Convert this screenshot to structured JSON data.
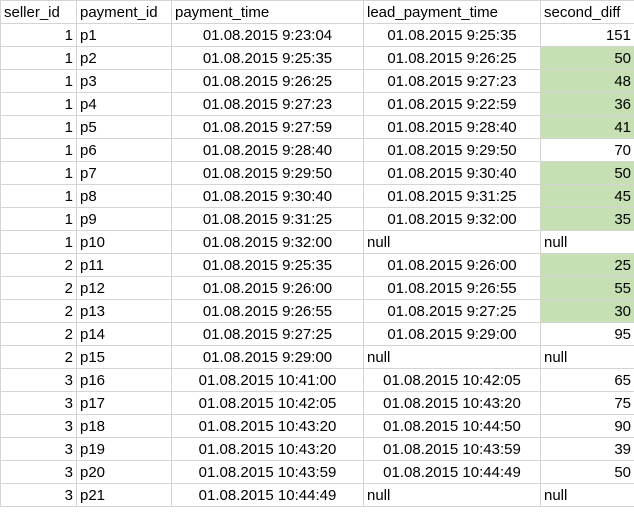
{
  "headers": [
    "seller_id",
    "payment_id",
    "payment_time",
    "lead_payment_time",
    "second_diff"
  ],
  "highlight_color": "#c6e0b4",
  "rows": [
    {
      "seller_id": "1",
      "payment_id": "p1",
      "payment_time": "01.08.2015 9:23:04",
      "lead_payment_time": "01.08.2015 9:25:35",
      "second_diff": "151",
      "highlight": false
    },
    {
      "seller_id": "1",
      "payment_id": "p2",
      "payment_time": "01.08.2015 9:25:35",
      "lead_payment_time": "01.08.2015 9:26:25",
      "second_diff": "50",
      "highlight": true
    },
    {
      "seller_id": "1",
      "payment_id": "p3",
      "payment_time": "01.08.2015 9:26:25",
      "lead_payment_time": "01.08.2015 9:27:23",
      "second_diff": "48",
      "highlight": true
    },
    {
      "seller_id": "1",
      "payment_id": "p4",
      "payment_time": "01.08.2015 9:27:23",
      "lead_payment_time": "01.08.2015 9:22:59",
      "second_diff": "36",
      "highlight": true
    },
    {
      "seller_id": "1",
      "payment_id": "p5",
      "payment_time": "01.08.2015 9:27:59",
      "lead_payment_time": "01.08.2015 9:28:40",
      "second_diff": "41",
      "highlight": true
    },
    {
      "seller_id": "1",
      "payment_id": "p6",
      "payment_time": "01.08.2015 9:28:40",
      "lead_payment_time": "01.08.2015 9:29:50",
      "second_diff": "70",
      "highlight": false
    },
    {
      "seller_id": "1",
      "payment_id": "p7",
      "payment_time": "01.08.2015 9:29:50",
      "lead_payment_time": "01.08.2015 9:30:40",
      "second_diff": "50",
      "highlight": true
    },
    {
      "seller_id": "1",
      "payment_id": "p8",
      "payment_time": "01.08.2015 9:30:40",
      "lead_payment_time": "01.08.2015 9:31:25",
      "second_diff": "45",
      "highlight": true
    },
    {
      "seller_id": "1",
      "payment_id": "p9",
      "payment_time": "01.08.2015 9:31:25",
      "lead_payment_time": "01.08.2015 9:32:00",
      "second_diff": "35",
      "highlight": true
    },
    {
      "seller_id": "1",
      "payment_id": "p10",
      "payment_time": "01.08.2015 9:32:00",
      "lead_payment_time": "null",
      "second_diff": "null",
      "highlight": false
    },
    {
      "seller_id": "2",
      "payment_id": "p11",
      "payment_time": "01.08.2015 9:25:35",
      "lead_payment_time": "01.08.2015 9:26:00",
      "second_diff": "25",
      "highlight": true
    },
    {
      "seller_id": "2",
      "payment_id": "p12",
      "payment_time": "01.08.2015 9:26:00",
      "lead_payment_time": "01.08.2015 9:26:55",
      "second_diff": "55",
      "highlight": true
    },
    {
      "seller_id": "2",
      "payment_id": "p13",
      "payment_time": "01.08.2015 9:26:55",
      "lead_payment_time": "01.08.2015 9:27:25",
      "second_diff": "30",
      "highlight": true
    },
    {
      "seller_id": "2",
      "payment_id": "p14",
      "payment_time": "01.08.2015 9:27:25",
      "lead_payment_time": "01.08.2015 9:29:00",
      "second_diff": "95",
      "highlight": false
    },
    {
      "seller_id": "2",
      "payment_id": "p15",
      "payment_time": "01.08.2015 9:29:00",
      "lead_payment_time": "null",
      "second_diff": "null",
      "highlight": false
    },
    {
      "seller_id": "3",
      "payment_id": "p16",
      "payment_time": "01.08.2015 10:41:00",
      "lead_payment_time": "01.08.2015 10:42:05",
      "second_diff": "65",
      "highlight": false
    },
    {
      "seller_id": "3",
      "payment_id": "p17",
      "payment_time": "01.08.2015 10:42:05",
      "lead_payment_time": "01.08.2015 10:43:20",
      "second_diff": "75",
      "highlight": false
    },
    {
      "seller_id": "3",
      "payment_id": "p18",
      "payment_time": "01.08.2015 10:43:20",
      "lead_payment_time": "01.08.2015 10:44:50",
      "second_diff": "90",
      "highlight": false
    },
    {
      "seller_id": "3",
      "payment_id": "p19",
      "payment_time": "01.08.2015 10:43:20",
      "lead_payment_time": "01.08.2015 10:43:59",
      "second_diff": "39",
      "highlight": false
    },
    {
      "seller_id": "3",
      "payment_id": "p20",
      "payment_time": "01.08.2015 10:43:59",
      "lead_payment_time": "01.08.2015 10:44:49",
      "second_diff": "50",
      "highlight": false
    },
    {
      "seller_id": "3",
      "payment_id": "p21",
      "payment_time": "01.08.2015 10:44:49",
      "lead_payment_time": "null",
      "second_diff": "null",
      "highlight": false
    }
  ]
}
